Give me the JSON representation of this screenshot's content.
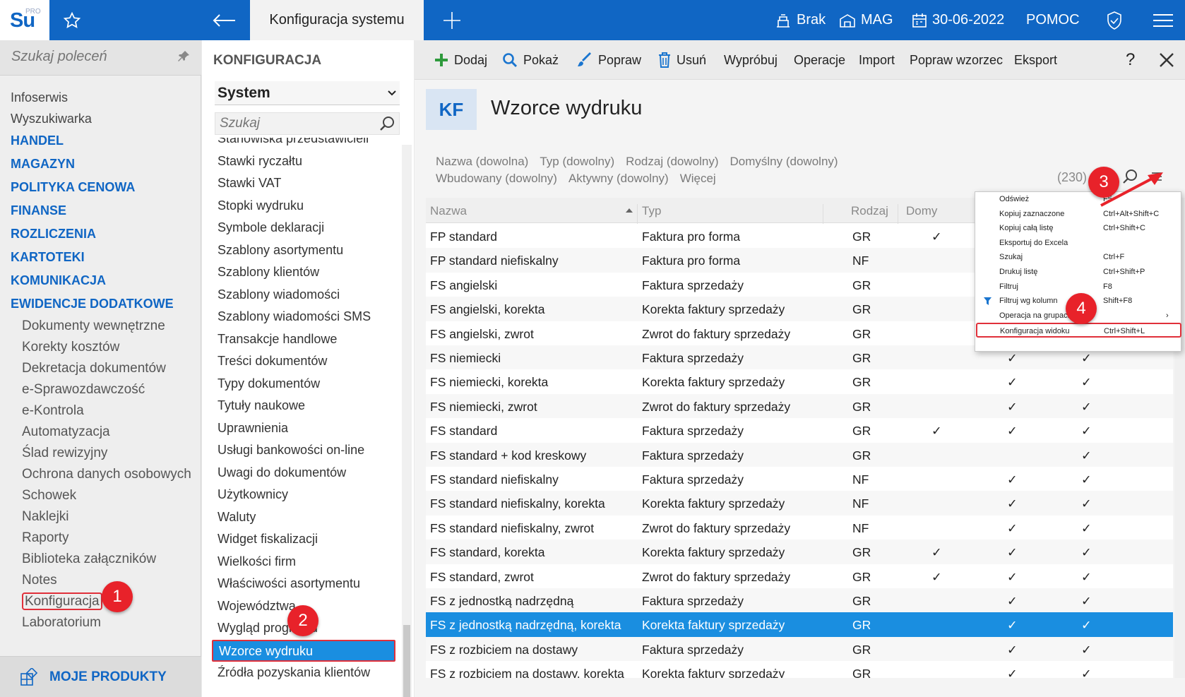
{
  "topbar": {
    "logo": "Su",
    "logo_sup": "PRO",
    "title": "Konfiguracja systemu",
    "brak": "Brak",
    "mag": "MAG",
    "date": "30-06-2022",
    "help": "POMOC"
  },
  "left": {
    "search_placeholder": "Szukaj poleceń",
    "items": [
      "Infoserwis",
      "Wyszukiwarka"
    ],
    "sections": [
      "HANDEL",
      "MAGAZYN",
      "POLITYKA CENOWA",
      "FINANSE",
      "ROZLICZENIA",
      "KARTOTEKI",
      "KOMUNIKACJA",
      "EWIDENCJE DODATKOWE"
    ],
    "subitems": [
      "Dokumenty wewnętrzne",
      "Korekty kosztów",
      "Dekretacja dokumentów",
      "e-Sprawozdawczość",
      "e-Kontrola",
      "Automatyzacja",
      "Ślad rewizyjny",
      "Ochrona danych osobowych",
      "Schowek",
      "Naklejki",
      "Raporty",
      "Biblioteka załączników",
      "Notes",
      "Konfiguracja",
      "Laboratorium"
    ],
    "moje_produkty": "MOJE PRODUKTY"
  },
  "middle": {
    "heading": "KONFIGURACJA",
    "select_value": "System",
    "search_placeholder": "Szukaj",
    "items": [
      "Stanowiska przedstawicieli",
      "Stawki ryczałtu",
      "Stawki VAT",
      "Stopki wydruku",
      "Symbole deklaracji",
      "Szablony asortymentu",
      "Szablony klientów",
      "Szablony wiadomości",
      "Szablony wiadomości SMS",
      "Transakcje handlowe",
      "Treści dokumentów",
      "Typy dokumentów",
      "Tytuły naukowe",
      "Uprawnienia",
      "Usługi bankowości on-line",
      "Uwagi do dokumentów",
      "Użytkownicy",
      "Waluty",
      "Widget fiskalizacji",
      "Wielkości firm",
      "Właściwości asortymentu",
      "Województwa",
      "Wygląd programu",
      "Wzorce wydruku",
      "Źródła pozyskania klientów"
    ]
  },
  "toolbar": {
    "dodaj": "Dodaj",
    "pokaz": "Pokaż",
    "popraw": "Popraw",
    "usun": "Usuń",
    "wyprobuj": "Wypróbuj",
    "operacje": "Operacje",
    "import": "Import",
    "popraw_wzorzec": "Popraw wzorzec",
    "eksport": "Eksport",
    "help": "?"
  },
  "header": {
    "badge": "KF",
    "title": "Wzorce wydruku"
  },
  "filters": [
    "Nazwa (dowolna)",
    "Typ (dowolny)",
    "Rodzaj (dowolny)",
    "Domyślny (dowolny)",
    "Wbudowany (dowolny)",
    "Aktywny (dowolny)",
    "Więcej"
  ],
  "count": "(230)",
  "grid": {
    "headers": [
      "Nazwa",
      "Typ",
      "Rodzaj",
      "Domy"
    ],
    "rows": [
      [
        "FP standard",
        "Faktura pro forma",
        "GR",
        "✓",
        "✓",
        "✓"
      ],
      [
        "FP standard niefiskalny",
        "Faktura pro forma",
        "NF",
        "",
        "✓",
        "✓"
      ],
      [
        "FS angielski",
        "Faktura sprzedaży",
        "GR",
        "",
        "✓",
        "✓"
      ],
      [
        "FS angielski, korekta",
        "Korekta faktury sprzedaży",
        "GR",
        "",
        "✓",
        "✓"
      ],
      [
        "FS angielski, zwrot",
        "Zwrot do faktury sprzedaży",
        "GR",
        "",
        "✓",
        "✓"
      ],
      [
        "FS niemiecki",
        "Faktura sprzedaży",
        "GR",
        "",
        "✓",
        "✓"
      ],
      [
        "FS niemiecki, korekta",
        "Korekta faktury sprzedaży",
        "GR",
        "",
        "✓",
        "✓"
      ],
      [
        "FS niemiecki, zwrot",
        "Zwrot do faktury sprzedaży",
        "GR",
        "",
        "✓",
        "✓"
      ],
      [
        "FS standard",
        "Faktura sprzedaży",
        "GR",
        "✓",
        "✓",
        "✓"
      ],
      [
        "FS standard + kod kreskowy",
        "Faktura sprzedaży",
        "GR",
        "",
        "",
        "✓"
      ],
      [
        "FS standard niefiskalny",
        "Faktura sprzedaży",
        "NF",
        "",
        "✓",
        "✓"
      ],
      [
        "FS standard niefiskalny, korekta",
        "Korekta faktury sprzedaży",
        "NF",
        "",
        "✓",
        "✓"
      ],
      [
        "FS standard niefiskalny, zwrot",
        "Zwrot do faktury sprzedaży",
        "NF",
        "",
        "✓",
        "✓"
      ],
      [
        "FS standard, korekta",
        "Korekta faktury sprzedaży",
        "GR",
        "✓",
        "✓",
        "✓"
      ],
      [
        "FS standard, zwrot",
        "Zwrot do faktury sprzedaży",
        "GR",
        "✓",
        "✓",
        "✓"
      ],
      [
        "FS z jednostką nadrzędną",
        "Faktura sprzedaży",
        "GR",
        "",
        "✓",
        "✓"
      ],
      [
        "FS z jednostką nadrzędną, korekta",
        "Korekta faktury sprzedaży",
        "GR",
        "",
        "✓",
        "✓"
      ],
      [
        "FS z rozbiciem na dostawy",
        "Faktura sprzedaży",
        "GR",
        "",
        "✓",
        "✓"
      ],
      [
        "FS z rozbiciem na dostawy, korekta",
        "Korekta faktury sprzedaży",
        "GR",
        "",
        "✓",
        "✓"
      ]
    ]
  },
  "context_menu": [
    {
      "label": "Odśwież",
      "shortcut": "F5"
    },
    {
      "label": "Kopiuj zaznaczone",
      "shortcut": "Ctrl+Alt+Shift+C"
    },
    {
      "label": "Kopiuj całą listę",
      "shortcut": "Ctrl+Shift+C"
    },
    {
      "label": "Eksportuj do Excela",
      "shortcut": ""
    },
    {
      "label": "Szukaj",
      "shortcut": "Ctrl+F"
    },
    {
      "label": "Drukuj listę",
      "shortcut": "Ctrl+Shift+P"
    },
    {
      "label": "Filtruj",
      "shortcut": "F8"
    },
    {
      "label": "Filtruj wg kolumn",
      "shortcut": "Shift+F8"
    },
    {
      "label": "Operacja na grupach",
      "shortcut": "›"
    },
    {
      "label": "Konfiguracja widoku",
      "shortcut": "Ctrl+Shift+L"
    }
  ],
  "badges": [
    "1",
    "2",
    "3",
    "4"
  ]
}
